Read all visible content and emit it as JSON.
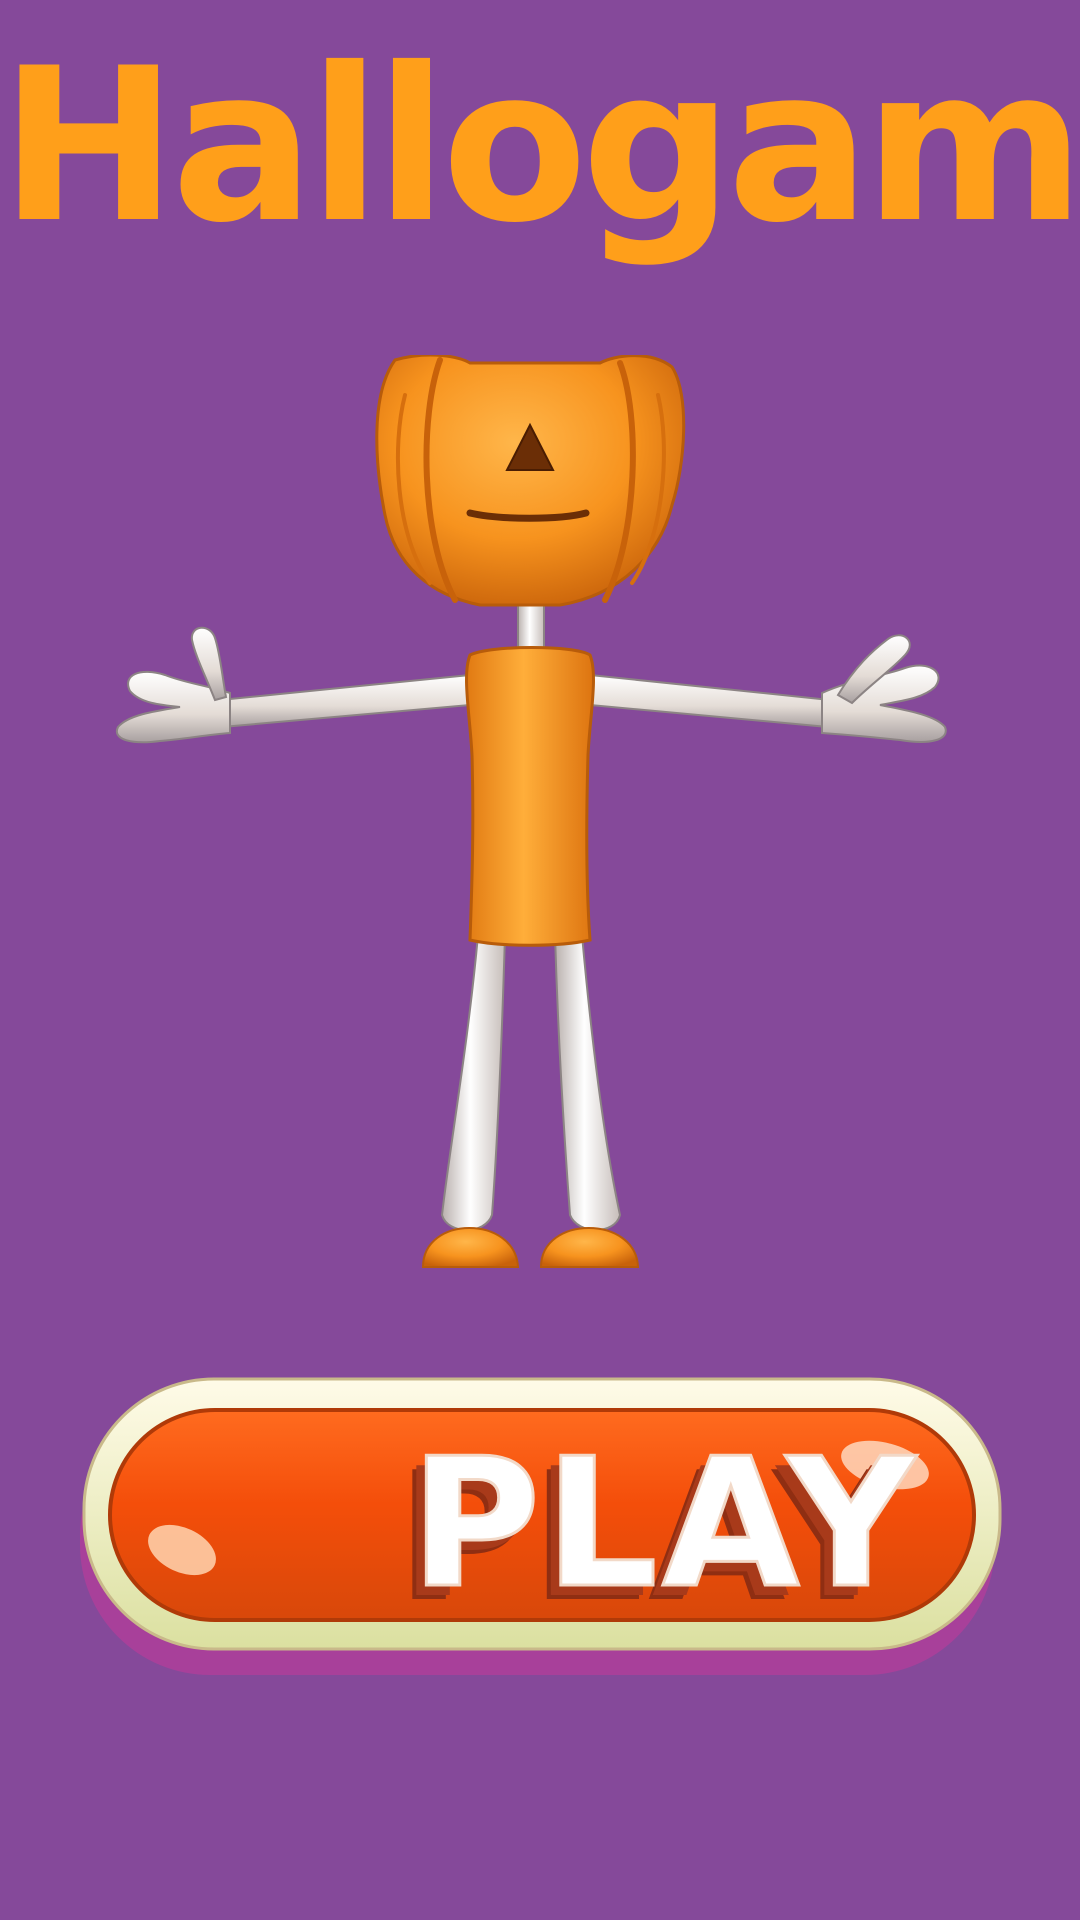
{
  "game": {
    "title": "Hallogame"
  },
  "character": {
    "name": "pumpkin-head-character"
  },
  "play_button": {
    "label": "PLAY"
  },
  "colors": {
    "background": "#85499a",
    "title": "#ff9f1a",
    "pumpkin": "#f7931e",
    "pumpkin_dark": "#c8620a",
    "limbs": "#e9e2dc",
    "button_orange": "#ff5a12",
    "button_rim": "#f1ecd0",
    "button_shadow": "#b03e9a"
  }
}
